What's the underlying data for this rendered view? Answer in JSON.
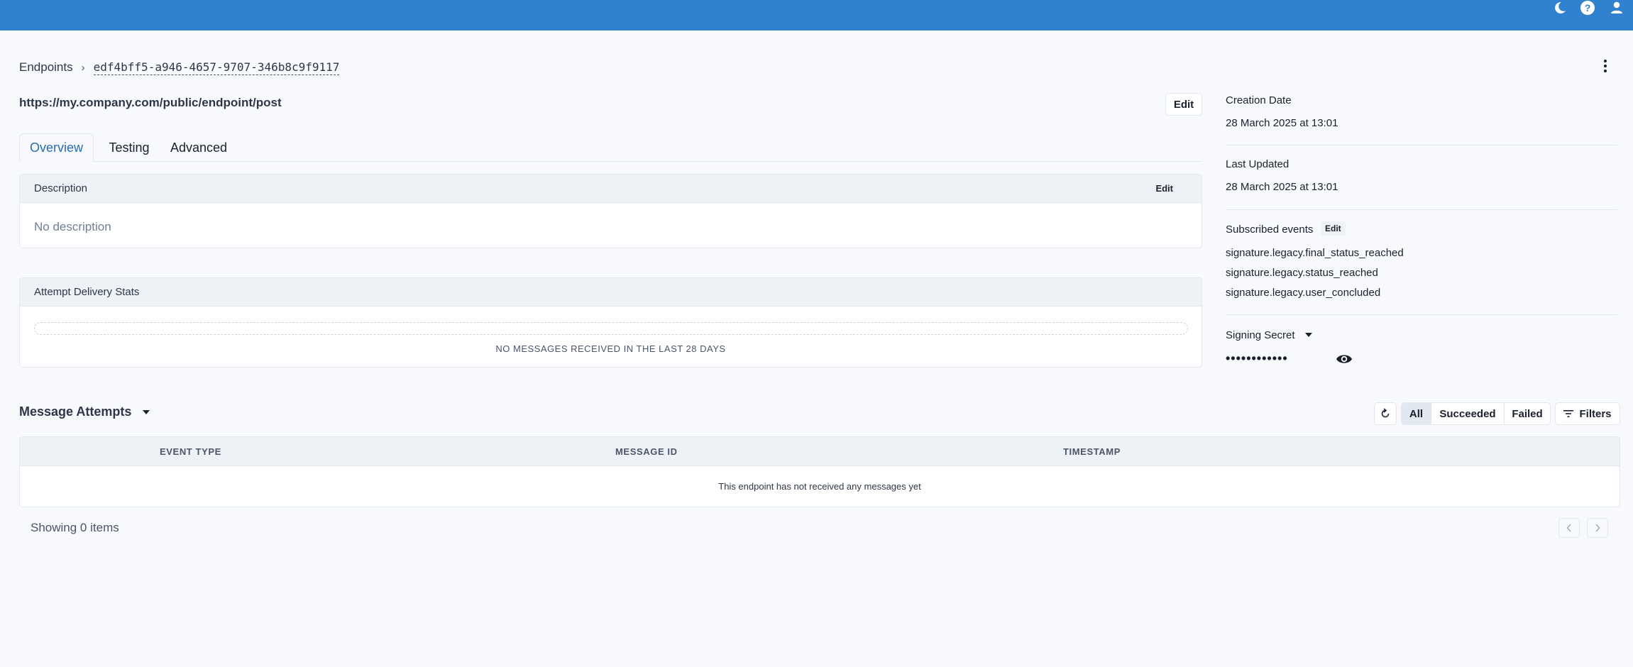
{
  "topbar": {
    "icons": [
      "moon-icon",
      "help-icon",
      "user-icon"
    ],
    "color": "#3182ce"
  },
  "breadcrumb": {
    "root": "Endpoints",
    "separator": "›",
    "current": "edf4bff5-a946-4657-9707-346b8c9f9117"
  },
  "endpoint": {
    "url": "https://my.company.com/public/endpoint/post",
    "edit_label": "Edit"
  },
  "tabs": [
    {
      "label": "Overview",
      "active": true
    },
    {
      "label": "Testing",
      "active": false
    },
    {
      "label": "Advanced",
      "active": false
    }
  ],
  "description_card": {
    "title": "Description",
    "edit_label": "Edit",
    "body": "No description"
  },
  "stats_card": {
    "title": "Attempt Delivery Stats",
    "empty_text": "NO MESSAGES RECEIVED IN THE LAST 28 DAYS"
  },
  "sidebar": {
    "creation_label": "Creation Date",
    "creation_value": "28 March 2025 at 13:01",
    "updated_label": "Last Updated",
    "updated_value": "28 March 2025 at 13:01",
    "events_label": "Subscribed events",
    "events_edit": "Edit",
    "events": [
      "signature.legacy.final_status_reached",
      "signature.legacy.status_reached",
      "signature.legacy.user_concluded"
    ],
    "secret_label": "Signing Secret",
    "secret_masked": "••••••••••••"
  },
  "message_attempts": {
    "title": "Message Attempts",
    "filters": [
      "All",
      "Succeeded",
      "Failed"
    ],
    "active_filter": "All",
    "filters_button": "Filters",
    "columns": [
      "EVENT TYPE",
      "MESSAGE ID",
      "TIMESTAMP"
    ],
    "empty_text": "This endpoint has not received any messages yet",
    "showing": "Showing 0 items"
  }
}
